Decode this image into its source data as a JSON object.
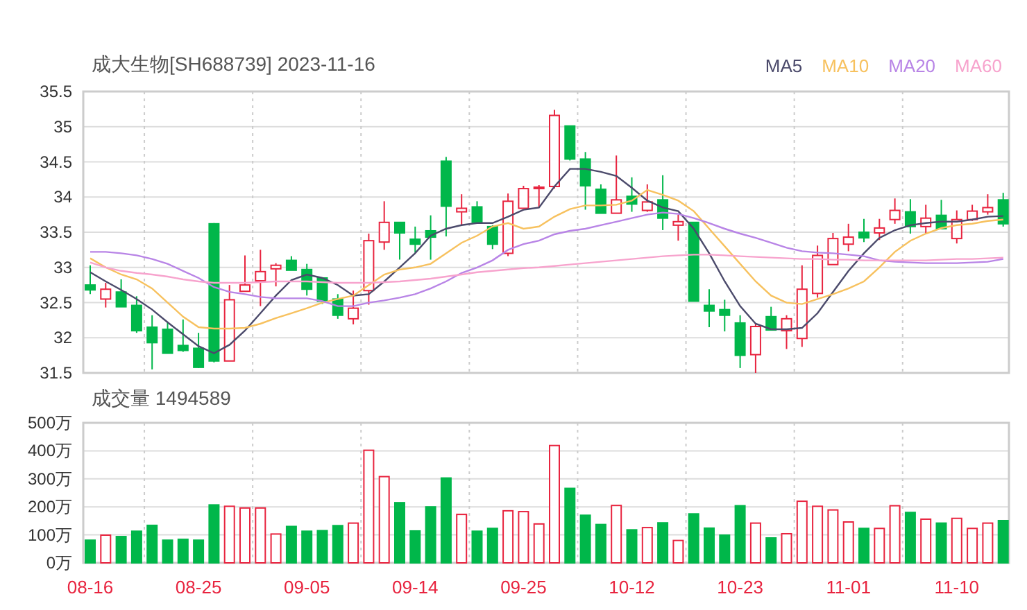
{
  "header": {
    "title": "成大生物[SH688739] 2023-11-16"
  },
  "price_panel": {
    "chart_data": {
      "type": "candlestick",
      "grid": true,
      "ylim": [
        31.5,
        35.5
      ],
      "yticks": [
        31.5,
        32,
        32.5,
        33,
        33.5,
        34,
        34.5,
        35,
        35.5
      ],
      "ohlc": [
        [
          32.75,
          33.03,
          32.62,
          32.68
        ],
        [
          32.55,
          32.78,
          32.43,
          32.69
        ],
        [
          32.65,
          32.83,
          32.44,
          32.44
        ],
        [
          32.46,
          32.59,
          32.07,
          32.1
        ],
        [
          32.15,
          32.32,
          31.55,
          31.93
        ],
        [
          32.12,
          32.22,
          31.78,
          31.78
        ],
        [
          31.89,
          32.26,
          31.8,
          31.82
        ],
        [
          31.85,
          32.07,
          31.57,
          31.58
        ],
        [
          33.62,
          33.63,
          31.65,
          31.67
        ],
        [
          31.67,
          32.75,
          31.67,
          32.54
        ],
        [
          32.66,
          33.17,
          32.66,
          32.75
        ],
        [
          32.81,
          33.25,
          32.45,
          32.94
        ],
        [
          32.98,
          33.06,
          32.73,
          33.03
        ],
        [
          33.1,
          33.16,
          32.96,
          32.96
        ],
        [
          32.97,
          33.05,
          32.6,
          32.69
        ],
        [
          32.85,
          32.85,
          32.48,
          32.52
        ],
        [
          32.55,
          32.62,
          32.27,
          32.32
        ],
        [
          32.27,
          32.67,
          32.19,
          32.42
        ],
        [
          32.67,
          33.48,
          32.47,
          33.38
        ],
        [
          33.36,
          33.94,
          33.25,
          33.64
        ],
        [
          33.64,
          33.64,
          33.11,
          33.49
        ],
        [
          33.4,
          33.58,
          33.21,
          33.33
        ],
        [
          33.52,
          33.74,
          33.11,
          33.43
        ],
        [
          34.51,
          34.57,
          33.44,
          33.87
        ],
        [
          33.79,
          34.04,
          33.6,
          33.84
        ],
        [
          33.86,
          33.94,
          33.64,
          33.64
        ],
        [
          33.58,
          33.6,
          33.26,
          33.33
        ],
        [
          33.2,
          34.05,
          33.16,
          33.94
        ],
        [
          33.84,
          34.16,
          33.84,
          34.12
        ],
        [
          34.12,
          34.17,
          33.85,
          34.14
        ],
        [
          34.15,
          35.24,
          34.12,
          35.16
        ],
        [
          35.01,
          35.01,
          34.52,
          34.54
        ],
        [
          34.54,
          34.64,
          33.82,
          34.16
        ],
        [
          34.11,
          34.18,
          33.77,
          33.77
        ],
        [
          33.77,
          34.59,
          33.77,
          33.96
        ],
        [
          34.01,
          34.28,
          33.79,
          33.9
        ],
        [
          33.81,
          34.18,
          33.79,
          33.93
        ],
        [
          33.96,
          34.31,
          33.53,
          33.7
        ],
        [
          33.6,
          33.75,
          33.38,
          33.65
        ],
        [
          33.64,
          33.64,
          32.52,
          32.52
        ],
        [
          32.46,
          32.69,
          32.15,
          32.38
        ],
        [
          32.4,
          32.54,
          32.09,
          32.32
        ],
        [
          32.21,
          32.32,
          31.57,
          31.75
        ],
        [
          31.76,
          32.2,
          31.5,
          32.16
        ],
        [
          32.3,
          32.44,
          32.11,
          32.11
        ],
        [
          32.1,
          32.32,
          31.84,
          32.27
        ],
        [
          31.99,
          33.03,
          31.87,
          32.69
        ],
        [
          32.63,
          33.31,
          32.57,
          33.17
        ],
        [
          33.04,
          33.49,
          33.04,
          33.41
        ],
        [
          33.33,
          33.62,
          33.23,
          33.43
        ],
        [
          33.5,
          33.69,
          33.36,
          33.42
        ],
        [
          33.49,
          33.69,
          33.39,
          33.56
        ],
        [
          33.68,
          33.98,
          33.62,
          33.81
        ],
        [
          33.79,
          33.97,
          33.48,
          33.58
        ],
        [
          33.58,
          33.89,
          33.48,
          33.7
        ],
        [
          33.74,
          33.96,
          33.55,
          33.55
        ],
        [
          33.41,
          33.81,
          33.34,
          33.68
        ],
        [
          33.68,
          33.89,
          33.66,
          33.8
        ],
        [
          33.79,
          34.04,
          33.75,
          33.85
        ],
        [
          33.96,
          34.06,
          33.58,
          33.62
        ]
      ],
      "series": [
        {
          "name": "MA5",
          "type": "line",
          "color": "#4b4a6b",
          "values": [
            32.93,
            32.8,
            32.68,
            32.55,
            32.4,
            32.22,
            32.05,
            31.88,
            31.78,
            31.9,
            32.1,
            32.35,
            32.6,
            32.82,
            32.9,
            32.85,
            32.75,
            32.6,
            32.62,
            32.8,
            33.0,
            33.2,
            33.45,
            33.55,
            33.6,
            33.63,
            33.63,
            33.72,
            33.82,
            33.85,
            34.15,
            34.4,
            34.4,
            34.36,
            34.3,
            34.13,
            33.95,
            33.85,
            33.8,
            33.55,
            33.2,
            32.8,
            32.45,
            32.2,
            32.12,
            32.12,
            32.14,
            32.35,
            32.65,
            32.95,
            33.2,
            33.42,
            33.53,
            33.6,
            33.63,
            33.65,
            33.65,
            33.68,
            33.72,
            33.73
          ]
        },
        {
          "name": "MA10",
          "type": "line",
          "color": "#f7c15e",
          "values": [
            33.13,
            33.0,
            32.9,
            32.83,
            32.7,
            32.5,
            32.3,
            32.15,
            32.13,
            32.13,
            32.14,
            32.2,
            32.28,
            32.35,
            32.42,
            32.5,
            32.55,
            32.6,
            32.75,
            32.9,
            32.97,
            33.0,
            33.05,
            33.2,
            33.35,
            33.45,
            33.58,
            33.63,
            33.55,
            33.58,
            33.72,
            33.83,
            33.88,
            33.88,
            33.89,
            33.95,
            34.1,
            34.03,
            33.95,
            33.8,
            33.55,
            33.3,
            33.05,
            32.8,
            32.6,
            32.5,
            32.48,
            32.55,
            32.62,
            32.7,
            32.8,
            33.0,
            33.22,
            33.38,
            33.48,
            33.56,
            33.6,
            33.62,
            33.66,
            33.68
          ]
        },
        {
          "name": "MA20",
          "type": "line",
          "color": "#b884e6",
          "values": [
            33.22,
            33.22,
            33.2,
            33.17,
            33.12,
            33.05,
            32.95,
            32.85,
            32.72,
            32.65,
            32.62,
            32.58,
            32.56,
            32.56,
            32.56,
            32.52,
            32.45,
            32.45,
            32.5,
            32.53,
            32.57,
            32.62,
            32.7,
            32.8,
            32.92,
            33.0,
            33.1,
            33.25,
            33.33,
            33.38,
            33.47,
            33.52,
            33.55,
            33.6,
            33.65,
            33.7,
            33.75,
            33.78,
            33.76,
            33.7,
            33.63,
            33.55,
            33.48,
            33.42,
            33.35,
            33.28,
            33.23,
            33.21,
            33.2,
            33.18,
            33.16,
            33.1,
            33.08,
            33.07,
            33.06,
            33.06,
            33.06,
            33.07,
            33.08,
            33.12
          ]
        },
        {
          "name": "MA60",
          "type": "line",
          "color": "#f7a3cd",
          "values": [
            33.07,
            33.0,
            32.95,
            32.92,
            32.9,
            32.87,
            32.83,
            32.8,
            32.78,
            32.78,
            32.78,
            32.79,
            32.8,
            32.8,
            32.8,
            32.79,
            32.78,
            32.78,
            32.78,
            32.79,
            32.8,
            32.82,
            32.84,
            32.87,
            32.9,
            32.93,
            32.95,
            32.97,
            32.99,
            33.0,
            33.02,
            33.04,
            33.06,
            33.08,
            33.1,
            33.12,
            33.14,
            33.16,
            33.17,
            33.18,
            33.18,
            33.17,
            33.16,
            33.15,
            33.14,
            33.13,
            33.12,
            33.12,
            33.11,
            33.11,
            33.1,
            33.1,
            33.1,
            33.1,
            33.1,
            33.11,
            33.12,
            33.12,
            33.13,
            33.14
          ]
        }
      ]
    }
  },
  "volume_panel": {
    "label": "成交量 1494589",
    "chart_data": {
      "type": "bar",
      "grid": true,
      "ylim": [
        0,
        500
      ],
      "categories": [
        "08-16",
        null,
        null,
        null,
        null,
        null,
        null,
        "08-25",
        null,
        null,
        null,
        null,
        null,
        null,
        "09-05",
        null,
        null,
        null,
        null,
        null,
        null,
        "09-14",
        null,
        null,
        null,
        null,
        null,
        null,
        "09-25",
        null,
        null,
        null,
        null,
        null,
        null,
        "10-12",
        null,
        null,
        null,
        null,
        null,
        null,
        "10-23",
        null,
        null,
        null,
        null,
        null,
        null,
        "11-01",
        null,
        null,
        null,
        null,
        null,
        null,
        "11-10",
        null,
        null,
        null
      ],
      "yticks": [
        {
          "value": 0,
          "label": "0万"
        },
        {
          "value": 100,
          "label": "100万"
        },
        {
          "value": 200,
          "label": "200万"
        },
        {
          "value": 300,
          "label": "300万"
        },
        {
          "value": 400,
          "label": "400万"
        },
        {
          "value": 500,
          "label": "500万"
        }
      ],
      "values": [
        81,
        99,
        94,
        113,
        134,
        81,
        84,
        81,
        207,
        202,
        196,
        196,
        103,
        130,
        113,
        115,
        133,
        142,
        402,
        308,
        215,
        114,
        200,
        303,
        173,
        113,
        123,
        186,
        183,
        139,
        419,
        266,
        170,
        137,
        205,
        118,
        126,
        143,
        80,
        175,
        124,
        99,
        204,
        142,
        89,
        104,
        220,
        202,
        189,
        146,
        123,
        123,
        204,
        180,
        156,
        142,
        159,
        123,
        142,
        151
      ]
    }
  }
}
